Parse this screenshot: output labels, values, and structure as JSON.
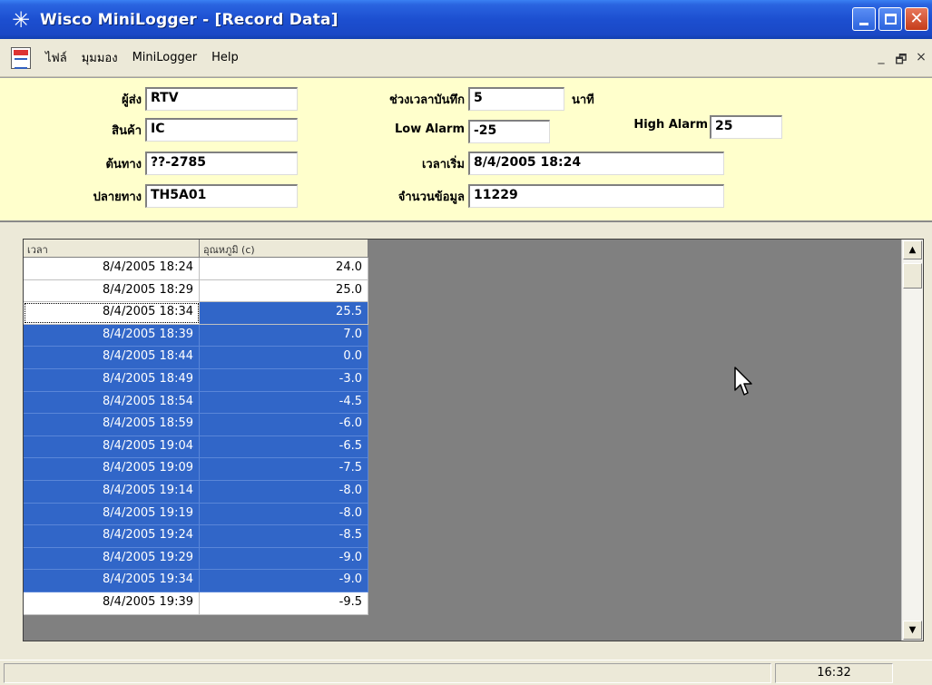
{
  "window": {
    "title": "Wisco MiniLogger - [Record Data]",
    "icon": "snowflake-icon"
  },
  "menu": {
    "items": [
      "ไฟล์",
      "มุมมอง",
      "MiniLogger",
      "Help"
    ],
    "mdi_controls": [
      "_",
      "🗗",
      "×"
    ]
  },
  "info": {
    "sender_label": "ผู้ส่ง",
    "sender_value": "RTV",
    "product_label": "สินค้า",
    "product_value": "IC",
    "origin_label": "ต้นทาง",
    "origin_value": "??-2785",
    "destination_label": "ปลายทาง",
    "destination_value": "TH5A01",
    "interval_label": "ช่วงเวลาบันทึก",
    "interval_value": "5",
    "interval_unit": "นาที",
    "low_alarm_label": "Low Alarm",
    "low_alarm_value": "-25",
    "high_alarm_label": "High Alarm",
    "high_alarm_value": "25",
    "start_time_label": "เวลาเริ่ม",
    "start_time_value": "8/4/2005  18:24",
    "record_count_label": "จำนวนข้อมูล",
    "record_count_value": "11229"
  },
  "grid": {
    "headers": [
      "เวลา",
      "อุณหภูมิ (c)"
    ],
    "rows": [
      {
        "time": "8/4/2005  18:24",
        "temp": "24.0",
        "state": "normal"
      },
      {
        "time": "8/4/2005  18:29",
        "temp": "25.0",
        "state": "normal"
      },
      {
        "time": "8/4/2005  18:34",
        "temp": "25.5",
        "state": "mixed"
      },
      {
        "time": "8/4/2005  18:39",
        "temp": "7.0",
        "state": "selected"
      },
      {
        "time": "8/4/2005  18:44",
        "temp": "0.0",
        "state": "selected"
      },
      {
        "time": "8/4/2005  18:49",
        "temp": "-3.0",
        "state": "selected"
      },
      {
        "time": "8/4/2005  18:54",
        "temp": "-4.5",
        "state": "selected"
      },
      {
        "time": "8/4/2005  18:59",
        "temp": "-6.0",
        "state": "selected"
      },
      {
        "time": "8/4/2005  19:04",
        "temp": "-6.5",
        "state": "selected"
      },
      {
        "time": "8/4/2005  19:09",
        "temp": "-7.5",
        "state": "selected"
      },
      {
        "time": "8/4/2005  19:14",
        "temp": "-8.0",
        "state": "selected"
      },
      {
        "time": "8/4/2005  19:19",
        "temp": "-8.0",
        "state": "selected"
      },
      {
        "time": "8/4/2005  19:24",
        "temp": "-8.5",
        "state": "selected"
      },
      {
        "time": "8/4/2005  19:29",
        "temp": "-9.0",
        "state": "selected"
      },
      {
        "time": "8/4/2005  19:34",
        "temp": "-9.0",
        "state": "selected"
      },
      {
        "time": "8/4/2005  19:39",
        "temp": "-9.5",
        "state": "normal"
      }
    ]
  },
  "status": {
    "time": "16:32"
  },
  "colors": {
    "title_bar": "#1c4fd0",
    "info_panel": "#ffffcc",
    "selection": "#3166c8",
    "grid_background": "#808080"
  }
}
